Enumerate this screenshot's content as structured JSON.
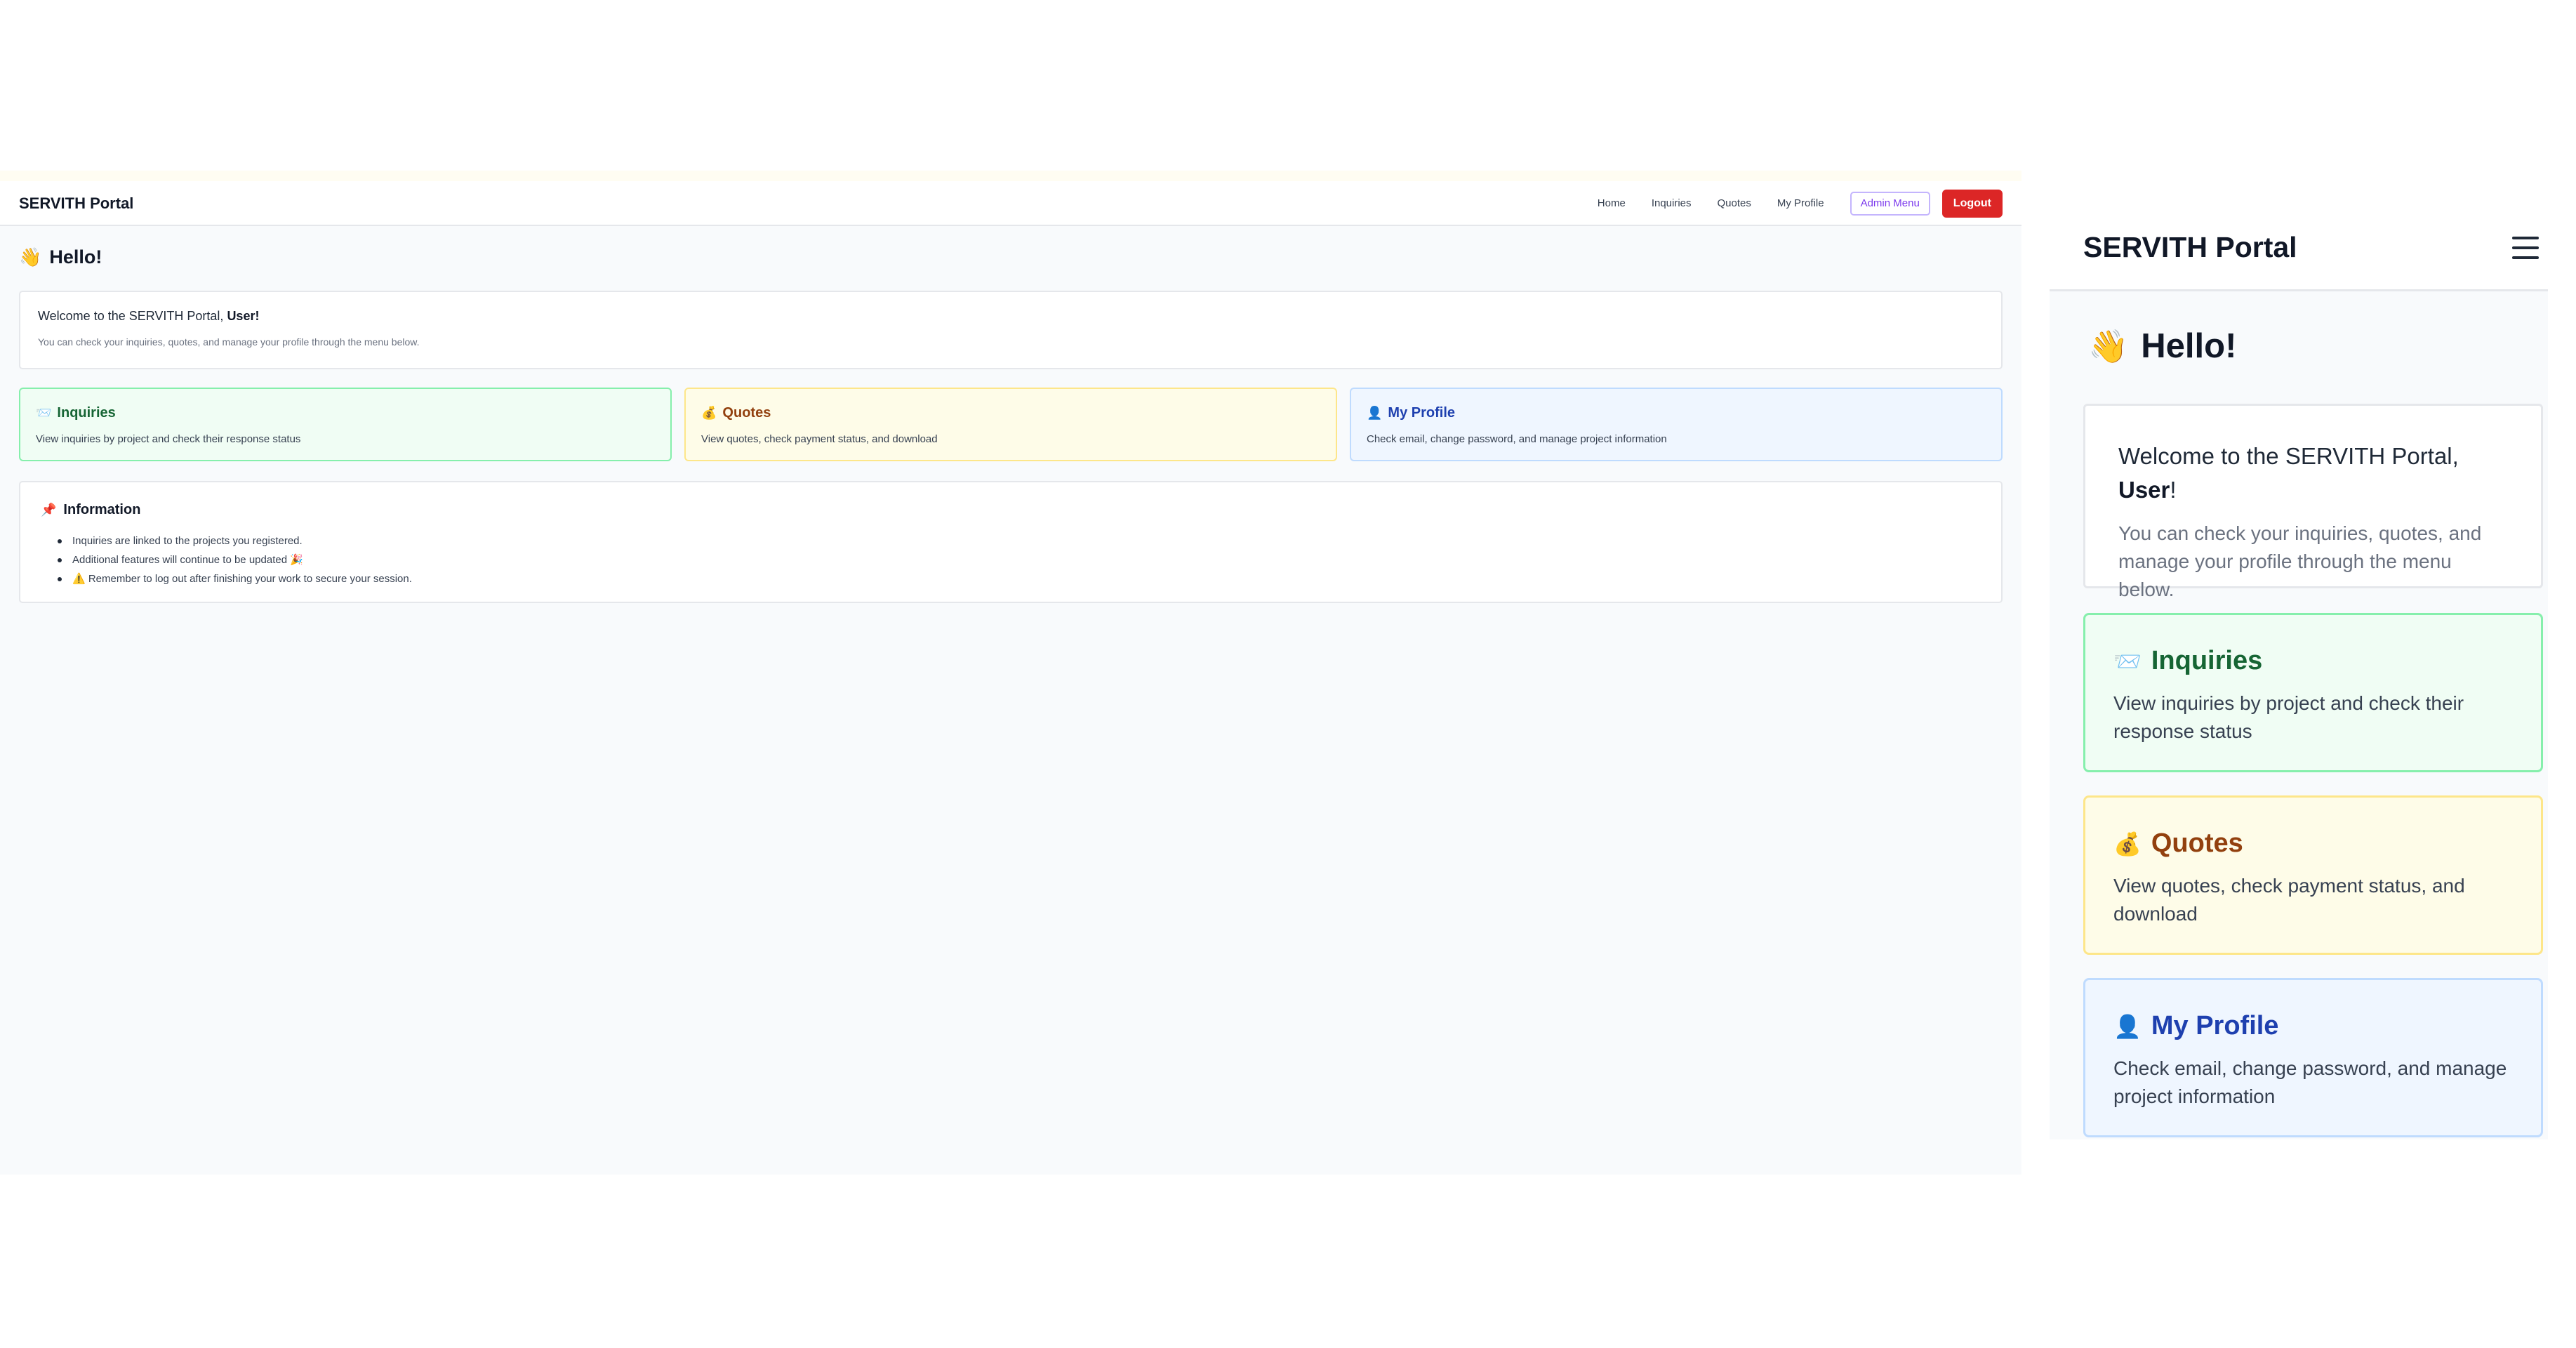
{
  "brand": "SERVITH Portal",
  "nav": {
    "home": "Home",
    "inquiries": "Inquiries",
    "quotes": "Quotes",
    "profile": "My Profile",
    "admin": "Admin Menu",
    "logout": "Logout"
  },
  "greeting": {
    "emoji": "👋",
    "text": "Hello!"
  },
  "welcome": {
    "prefix": "Welcome to the SERVITH Portal, ",
    "user": "User",
    "suffix": "!",
    "subtitle": "You can check your inquiries, quotes, and manage your profile through the menu below."
  },
  "cards": {
    "inquiries": {
      "icon": "📨",
      "title": "Inquiries",
      "desc": "View inquiries by project and check their response status"
    },
    "quotes": {
      "icon": "💰",
      "title": "Quotes",
      "desc": "View quotes, check payment status, and download"
    },
    "profile": {
      "icon": "👤",
      "title": "My Profile",
      "desc": "Check email, change password, and manage project information"
    }
  },
  "info": {
    "icon": "📌",
    "title": "Information",
    "items": [
      "Inquiries are linked to the projects you registered.",
      "Additional features will continue to be updated 🎉",
      "⚠️ Remember to log out after finishing your work to secure your session."
    ]
  },
  "mobile": {
    "menu_icon": "hamburger-icon"
  },
  "colors": {
    "logout": "#dc2626",
    "admin": "#7c3aed",
    "inquiries_bg": "#f0fdf4",
    "quotes_bg": "#fefce8",
    "profile_bg": "#eff6ff"
  }
}
